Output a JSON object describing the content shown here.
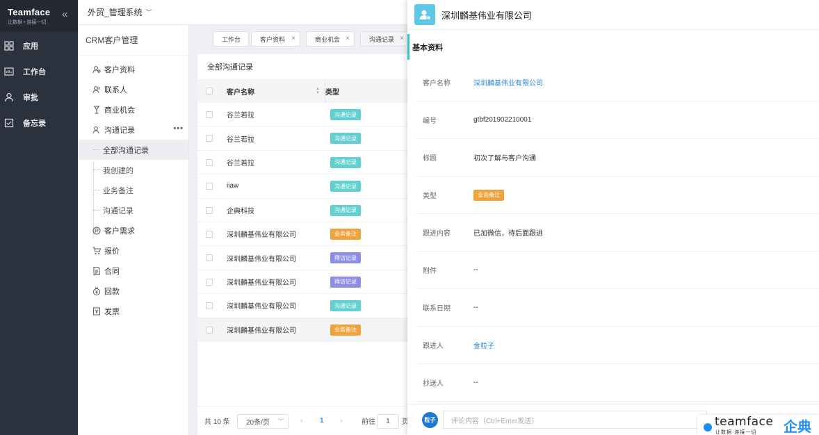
{
  "brand": {
    "name": "Teamface",
    "slogan": "让数据 • 连接一切"
  },
  "nav": [
    {
      "label": "应用",
      "icon": "grid-icon"
    },
    {
      "label": "工作台",
      "icon": "dashboard-icon"
    },
    {
      "label": "审批",
      "icon": "user-icon"
    },
    {
      "label": "备忘录",
      "icon": "memo-icon"
    }
  ],
  "header": {
    "system": "外贸_管理系统"
  },
  "menu": {
    "title": "CRM客户管理",
    "items": [
      {
        "label": "客户资料",
        "icon": "users-icon"
      },
      {
        "label": "联系人",
        "icon": "contact-icon"
      },
      {
        "label": "商业机会",
        "icon": "opportunity-icon"
      },
      {
        "label": "沟通记录",
        "icon": "chat-icon"
      }
    ],
    "sub": [
      {
        "label": "全部沟通记录"
      },
      {
        "label": "我创建的"
      },
      {
        "label": "业务备注"
      },
      {
        "label": "沟通记录"
      }
    ],
    "more": "•••",
    "items2": [
      {
        "label": "客户需求",
        "icon": "demand-icon"
      },
      {
        "label": "报价",
        "icon": "cart-icon"
      },
      {
        "label": "合同",
        "icon": "contract-icon"
      },
      {
        "label": "回款",
        "icon": "payment-icon"
      },
      {
        "label": "发票",
        "icon": "invoice-icon"
      }
    ]
  },
  "tabs": [
    {
      "label": "工作台"
    },
    {
      "label": "客户资料"
    },
    {
      "label": "商业机会"
    },
    {
      "label": "沟通记录"
    }
  ],
  "table": {
    "title": "全部沟通记录",
    "col_name": "客户名称",
    "col_type": "类型",
    "rows": [
      {
        "name": "谷兰若拉",
        "type": "沟通记录",
        "color": "#62cfd0"
      },
      {
        "name": "谷兰若拉",
        "type": "沟通记录",
        "color": "#62cfd0"
      },
      {
        "name": "谷兰若拉",
        "type": "沟通记录",
        "color": "#62cfd0"
      },
      {
        "name": "iiaw",
        "type": "沟通记录",
        "color": "#62cfd0"
      },
      {
        "name": "企典科技",
        "type": "沟通记录",
        "color": "#62cfd0"
      },
      {
        "name": "深圳麟基伟业有限公司",
        "type": "业务备注",
        "color": "#f2a23a"
      },
      {
        "name": "深圳麟基伟业有限公司",
        "type": "拜访记录",
        "color": "#8d8fe6"
      },
      {
        "name": "深圳麟基伟业有限公司",
        "type": "拜访记录",
        "color": "#8d8fe6"
      },
      {
        "name": "深圳麟基伟业有限公司",
        "type": "沟通记录",
        "color": "#62cfd0"
      },
      {
        "name": "深圳麟基伟业有限公司",
        "type": "业务备注",
        "color": "#f2a23a"
      }
    ]
  },
  "pager": {
    "total": "共 10 条",
    "size": "20条/页",
    "prev": "‹",
    "page": "1",
    "next": "›",
    "goto_label": "前往",
    "goto_value": "1",
    "page_unit": "页"
  },
  "detail": {
    "title": "深圳麟基伟业有限公司",
    "section": "基本资料",
    "fields": {
      "customer_label": "客户名称",
      "customer_value": "深圳麟基伟业有限公司",
      "code_label": "编号",
      "code_value": "gtbf201902210001",
      "subject_label": "标题",
      "subject_value": "初次了解与客户沟通",
      "type_label": "类型",
      "type_value": "业务备注",
      "content_label": "跟进内容",
      "content_value": "已加微信，待后面跟进",
      "attach_label": "附件",
      "attach_value": "--",
      "date_label": "联系日期",
      "date_value": "--",
      "follower_label": "跟进人",
      "follower_value": "金粒子",
      "cc_label": "抄送人",
      "cc_value": "--"
    },
    "comment": {
      "avatar": "粒子",
      "placeholder": "评论内容（Ctrl+Enter发送）"
    }
  },
  "watermark": {
    "brand": "teamface",
    "cn": "企典",
    "tagline": "让数据·连接一切"
  },
  "colors": {
    "nav_bg": "#2b313d",
    "teal": "#62cfd0",
    "orange": "#f2a23a",
    "purple": "#8d8fe6",
    "link": "#2a87d6"
  }
}
